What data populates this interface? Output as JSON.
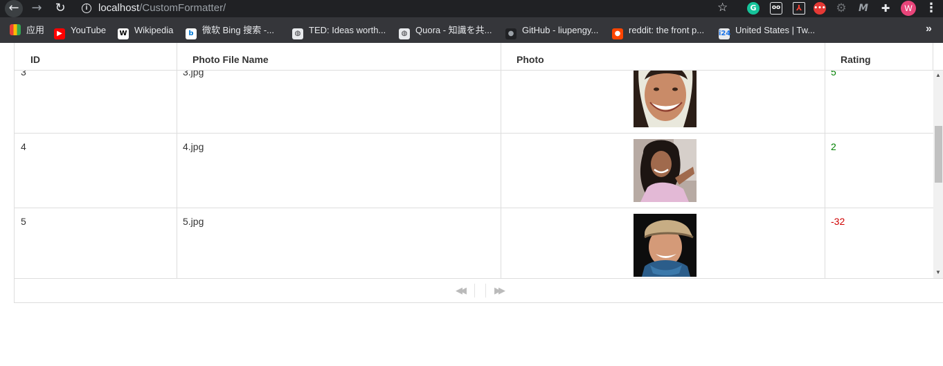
{
  "browser": {
    "url_host": "localhost",
    "url_path": "/CustomFormatter/",
    "avatar_letter": "W"
  },
  "bookmarks": [
    {
      "label": "应用",
      "icon": "apps-grid-icon"
    },
    {
      "label": "YouTube",
      "icon": "youtube-icon"
    },
    {
      "label": "Wikipedia",
      "icon": "wikipedia-icon"
    },
    {
      "label": "微软 Bing 搜索 -...",
      "icon": "bing-icon"
    },
    {
      "label": "TED: Ideas worth...",
      "icon": "globe-icon"
    },
    {
      "label": "Quora - 知識を共...",
      "icon": "globe-icon"
    },
    {
      "label": "GitHub - liupengy...",
      "icon": "github-icon"
    },
    {
      "label": "reddit: the front p...",
      "icon": "reddit-icon"
    },
    {
      "label": "United States | Tw...",
      "icon": "i24-icon"
    }
  ],
  "grid": {
    "columns": {
      "id": "ID",
      "file": "Photo File Name",
      "photo": "Photo",
      "rating": "Rating"
    },
    "rows": [
      {
        "id": "3",
        "file": "3.jpg",
        "rating": "5",
        "rating_color": "#008000"
      },
      {
        "id": "4",
        "file": "4.jpg",
        "rating": "2",
        "rating_color": "#008000"
      },
      {
        "id": "5",
        "file": "5.jpg",
        "rating": "-32",
        "rating_color": "#d00000"
      }
    ]
  }
}
